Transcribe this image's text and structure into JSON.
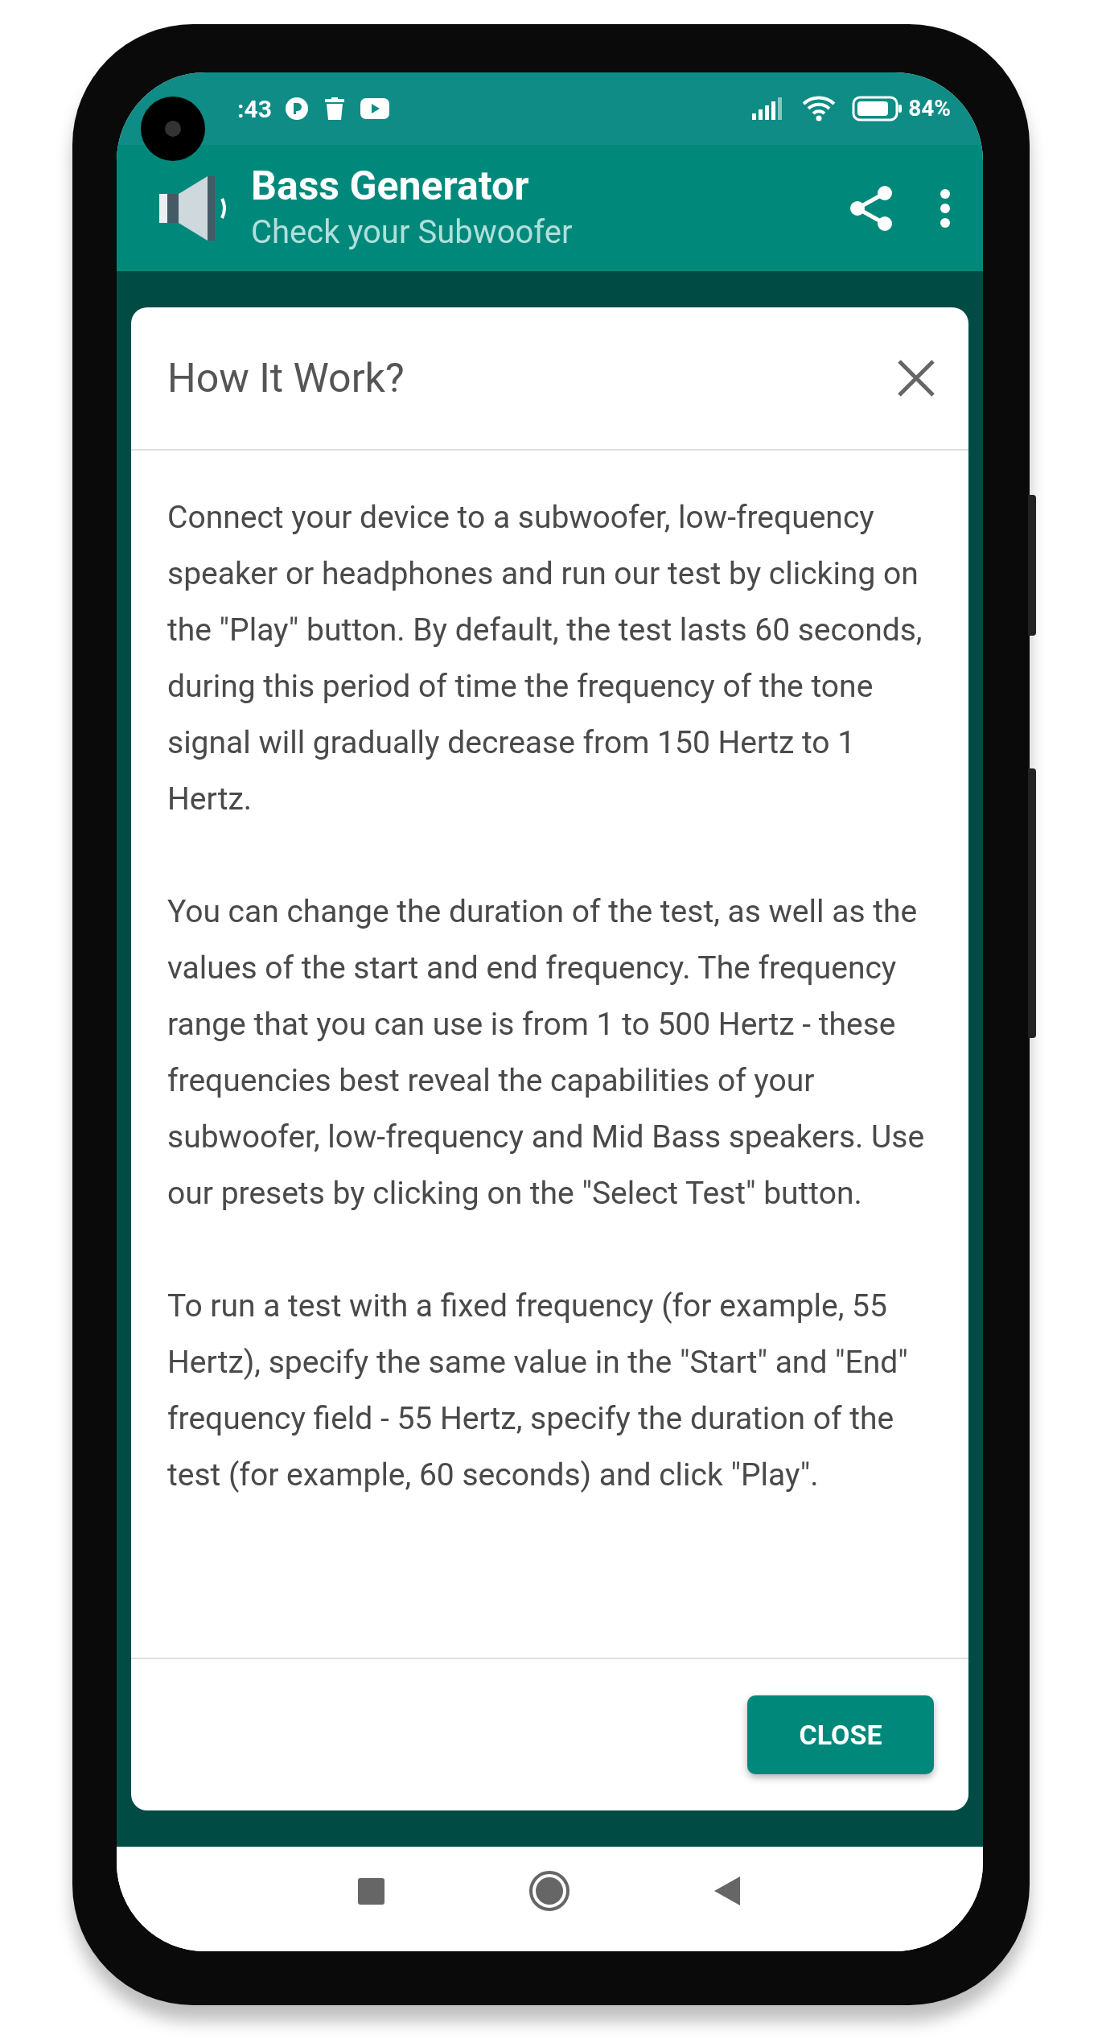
{
  "status_bar": {
    "time": ":43",
    "battery": "84%"
  },
  "app_bar": {
    "title": "Bass Generator",
    "subtitle": "Check your Subwoofer"
  },
  "dialog": {
    "title": "How It Work?",
    "paragraphs": [
      "Connect your device to a subwoofer, low-frequency speaker or headphones and run our test by clicking on the \"Play\" button. By default, the test lasts 60 seconds, during this period of time the frequency of the tone signal will gradually decrease from 150 Hertz to 1 Hertz.",
      "You can change the duration of the test, as well as the values of the start and end frequency. The frequency range that you can use is from 1 to 500 Hertz - these frequencies best reveal the capabilities of your subwoofer, low-frequency and Mid Bass speakers. Use our presets by clicking on the \"Select Test\" button.",
      "To run a test with a fixed frequency (for example, 55 Hertz), specify the same value in the \"Start\" and \"End\" frequency field - 55 Hertz, specify the duration of the test (for example, 60 seconds) and click \"Play\"."
    ],
    "button": "CLOSE"
  }
}
